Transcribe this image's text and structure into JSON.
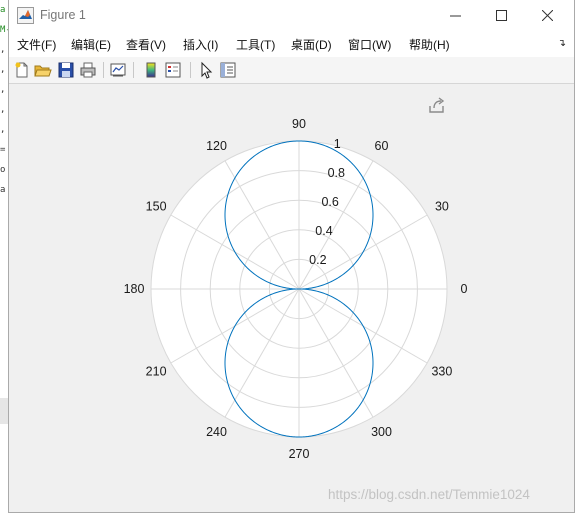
{
  "window": {
    "title": "Figure 1",
    "icon": "matlab-icon"
  },
  "menu": [
    {
      "label": "文件(F)"
    },
    {
      "label": "编辑(E)"
    },
    {
      "label": "查看(V)"
    },
    {
      "label": "插入(I)"
    },
    {
      "label": "工具(T)"
    },
    {
      "label": "桌面(D)"
    },
    {
      "label": "窗口(W)"
    },
    {
      "label": "帮助(H)"
    }
  ],
  "toolbar": {
    "icons": [
      "new-figure-icon",
      "open-file-icon",
      "save-icon",
      "print-icon",
      "link-plot-icon",
      "colorbar-icon",
      "legend-icon",
      "pointer-icon",
      "property-inspector-icon"
    ]
  },
  "plot": {
    "theta_ticks": [
      "0",
      "30",
      "60",
      "90",
      "120",
      "150",
      "180",
      "210",
      "240",
      "270",
      "300",
      "330"
    ],
    "r_ticks": [
      "0.2",
      "0.4",
      "0.6",
      "0.8",
      "1"
    ],
    "line_color": "#0072bd",
    "grid_color": "#d9d9d9"
  },
  "chart_data": {
    "type": "line",
    "projection": "polar",
    "series": [
      {
        "function": "r = |sin(θ)|",
        "theta_deg": [
          0,
          15,
          30,
          45,
          60,
          75,
          90,
          105,
          120,
          135,
          150,
          165,
          180,
          195,
          210,
          225,
          240,
          255,
          270,
          285,
          300,
          315,
          330,
          345,
          360
        ],
        "r": [
          0,
          0.26,
          0.5,
          0.71,
          0.87,
          0.97,
          1.0,
          0.97,
          0.87,
          0.71,
          0.5,
          0.26,
          0,
          0.26,
          0.5,
          0.71,
          0.87,
          0.97,
          1.0,
          0.97,
          0.87,
          0.71,
          0.5,
          0.26,
          0
        ]
      }
    ],
    "theta_ticks_deg": [
      0,
      30,
      60,
      90,
      120,
      150,
      180,
      210,
      240,
      270,
      300,
      330
    ],
    "r_ticks": [
      0.2,
      0.4,
      0.6,
      0.8,
      1
    ],
    "rlim": [
      0,
      1
    ],
    "grid": true
  },
  "watermark": "https://blog.csdn.net/Temmie1024"
}
